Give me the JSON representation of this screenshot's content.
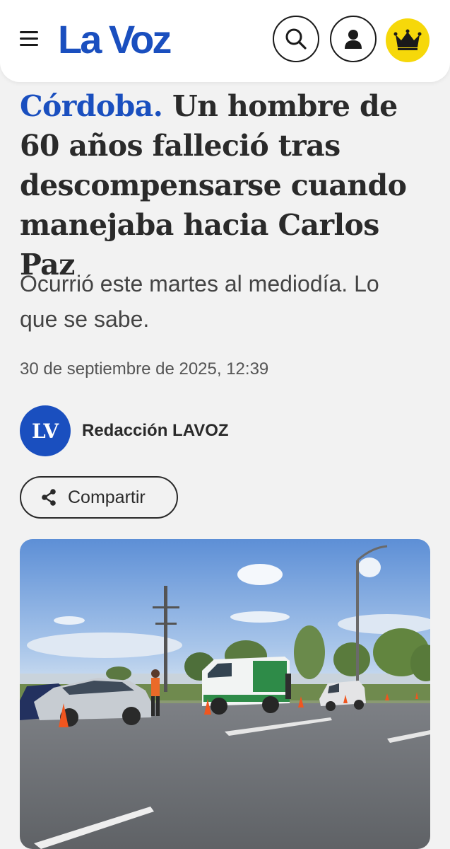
{
  "header": {
    "logo": "La Voz",
    "icons": {
      "menu": "menu-icon",
      "search": "search-icon",
      "user": "user-icon",
      "premium": "crown-icon"
    },
    "brand_color": "#1a4fbf",
    "premium_color": "#f6d80a"
  },
  "article": {
    "kicker": "Córdoba.",
    "headline": "Un hombre de 60 años falleció tras descompensarse cuando manejaba hacia Carlos Paz",
    "subheadline": "Ocurrió este martes al mediodía. Lo que se sabe.",
    "date": "30 de septiembre de 2025, 12:39",
    "author": {
      "initials": "LV",
      "name": "Redacción LAVOZ"
    },
    "share_label": "Compartir"
  }
}
